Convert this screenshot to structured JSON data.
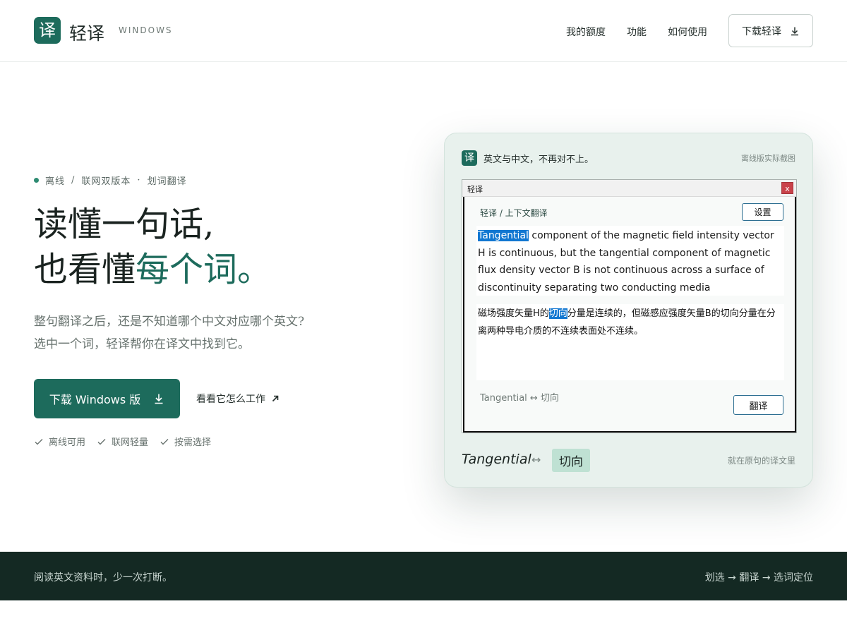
{
  "header": {
    "logo_char": "译",
    "brand": "轻译",
    "brand_sub": "WINDOWS",
    "nav": [
      "我的额度",
      "功能",
      "如何使用"
    ],
    "download_label": "下载轻译"
  },
  "hero": {
    "eyebrow": [
      "离线",
      "/",
      "联网双版本",
      "·",
      "划词翻译"
    ],
    "headline_line1": "读懂一句话,",
    "headline_line2_plain": "也看懂",
    "headline_line2_accent": "每个词",
    "headline_line2_end": "。",
    "sub_line1": "整句翻译之后，还是不知道哪个中文对应哪个英文?",
    "sub_line2": "选中一个词，轻译帮你在译文中找到它。",
    "primary_label": "下载 Windows 版",
    "secondary_label": "看看它怎么工作",
    "checks": [
      "离线可用",
      "联网轻量",
      "按需选择"
    ]
  },
  "preview": {
    "logo_char": "译",
    "tagline": "英文与中文，不再对不上。",
    "note": "离线版实际截图",
    "window": {
      "title": "轻译",
      "close": "x",
      "breadcrumb": "轻译  /  上下文翻译",
      "settings_label": "设置",
      "source_highlight": "Tangential",
      "source_rest": " component of the magnetic field intensity vector H is continuous, but the tangential component of magnetic flux density vector B is not continuous across a surface of discontinuity separating two conducting media",
      "target_before": "磁场强度矢量H的",
      "target_highlight": "切向",
      "target_after": "分量是连续的，但磁感应强度矢量B的切向分量在分离两种导电介质的不连续表面处不连续。",
      "pair_label": "Tangential ↔ 切向",
      "translate_label": "翻译"
    },
    "pair_en": "Tangential",
    "pair_arrow": "↔",
    "pair_zh": "切向",
    "caption": "就在原句的译文里"
  },
  "footer": {
    "left": "阅读英文资料时，少一次打断。",
    "right": "划选 → 翻译 → 选词定位"
  },
  "colors": {
    "brand": "#1d6b5c",
    "highlight": "#1177d1",
    "footer_bg": "#142923",
    "card_bg": "#e8f1ed"
  }
}
